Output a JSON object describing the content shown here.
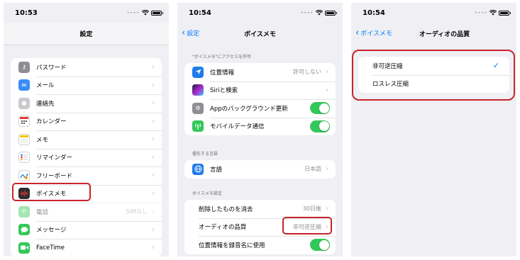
{
  "panel1": {
    "time": "10:53",
    "title": "設定",
    "items": [
      {
        "label": "パスワード",
        "icon": "key-icon"
      },
      {
        "label": "メール",
        "icon": "mail-icon"
      },
      {
        "label": "連絡先",
        "icon": "contacts-icon"
      },
      {
        "label": "カレンダー",
        "icon": "calendar-icon"
      },
      {
        "label": "メモ",
        "icon": "notes-icon"
      },
      {
        "label": "リマインダー",
        "icon": "reminders-icon"
      },
      {
        "label": "フリーボード",
        "icon": "freeform-icon"
      },
      {
        "label": "ボイスメモ",
        "icon": "voice-memos-icon"
      },
      {
        "label": "電話",
        "icon": "phone-icon",
        "value": "SIMなし"
      },
      {
        "label": "メッセージ",
        "icon": "messages-icon"
      },
      {
        "label": "FaceTime",
        "icon": "facetime-icon"
      }
    ]
  },
  "panel2": {
    "time": "10:54",
    "back": "設定",
    "title": "ボイスメモ",
    "section1_header": "\"ボイスメモ\"にアクセスを許可",
    "section1": [
      {
        "label": "位置情報",
        "value": "許可しない",
        "icon": "location-icon"
      },
      {
        "label": "Siriと検索",
        "icon": "siri-icon"
      },
      {
        "label": "Appのバックグラウンド更新",
        "icon": "gear-icon",
        "toggle": true
      },
      {
        "label": "モバイルデータ通信",
        "icon": "cellular-icon",
        "toggle": true
      }
    ],
    "section2_header": "優先する言語",
    "section2": [
      {
        "label": "言語",
        "value": "日本語",
        "icon": "globe-icon"
      }
    ],
    "section3_header": "ボイスメモ設定",
    "section3": [
      {
        "label": "削除したものを消去",
        "value": "30日後"
      },
      {
        "label": "オーディオの品質",
        "value": "非可逆圧縮"
      },
      {
        "label": "位置情報を録音名に使用",
        "toggle": true
      }
    ]
  },
  "panel3": {
    "time": "10:54",
    "back": "ボイスメモ",
    "title": "オーディオの品質",
    "options": [
      {
        "label": "非可逆圧縮",
        "selected": true
      },
      {
        "label": "ロスレス圧縮",
        "selected": false
      }
    ]
  },
  "colors": {
    "accent": "#007aff",
    "toggle_on": "#34c759",
    "highlight": "#c8232c",
    "background": "#efeff4"
  }
}
